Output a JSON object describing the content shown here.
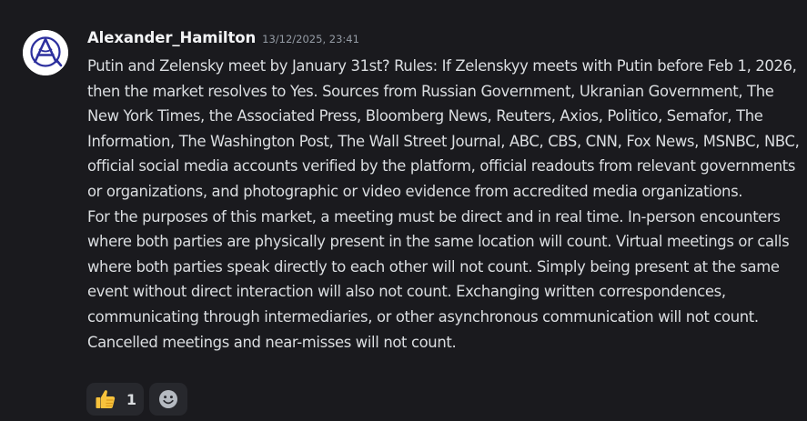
{
  "message": {
    "author": "Alexander_Hamilton",
    "timestamp": "13/12/2025, 23:41",
    "paragraphs": [
      "Putin and Zelensky meet by January 31st? Rules: If Zelenskyy meets with Putin before Feb 1, 2026, then the market resolves to Yes. Sources from Russian Government, Ukranian Government, The New York Times, the Associated Press, Bloomberg News, Reuters, Axios, Politico, Semafor, The Information, The Washington Post, The Wall Street Journal, ABC, CBS, CNN, Fox News, MSNBC, NBC, official social media accounts verified by the platform, official readouts from relevant governments or organizations, and photographic or video evidence from accredited media organizations.",
      "For the purposes of this market, a meeting must be direct and in real time. In-person encounters where both parties are physically present in the same location will count. Virtual meetings or calls where both parties speak directly to each other will not count. Simply being present at the same event without direct interaction will also not count. Exchanging written correspondences, communicating through intermediaries, or other asynchronous communication will not count. Cancelled meetings and near-misses will not count."
    ],
    "avatar_icon": "circle-a-logo-icon"
  },
  "reactions": [
    {
      "emoji_icon": "thumbs-up-icon",
      "count": "1"
    }
  ],
  "add_reaction_icon": "smiley-add-reaction-icon",
  "colors": {
    "background": "#1a1a1e",
    "text": "#dbdee1",
    "username": "#f2f3f5",
    "timestamp": "#949ba4",
    "reaction_bg": "#27282d",
    "avatar_blue": "#2c2f9e"
  }
}
